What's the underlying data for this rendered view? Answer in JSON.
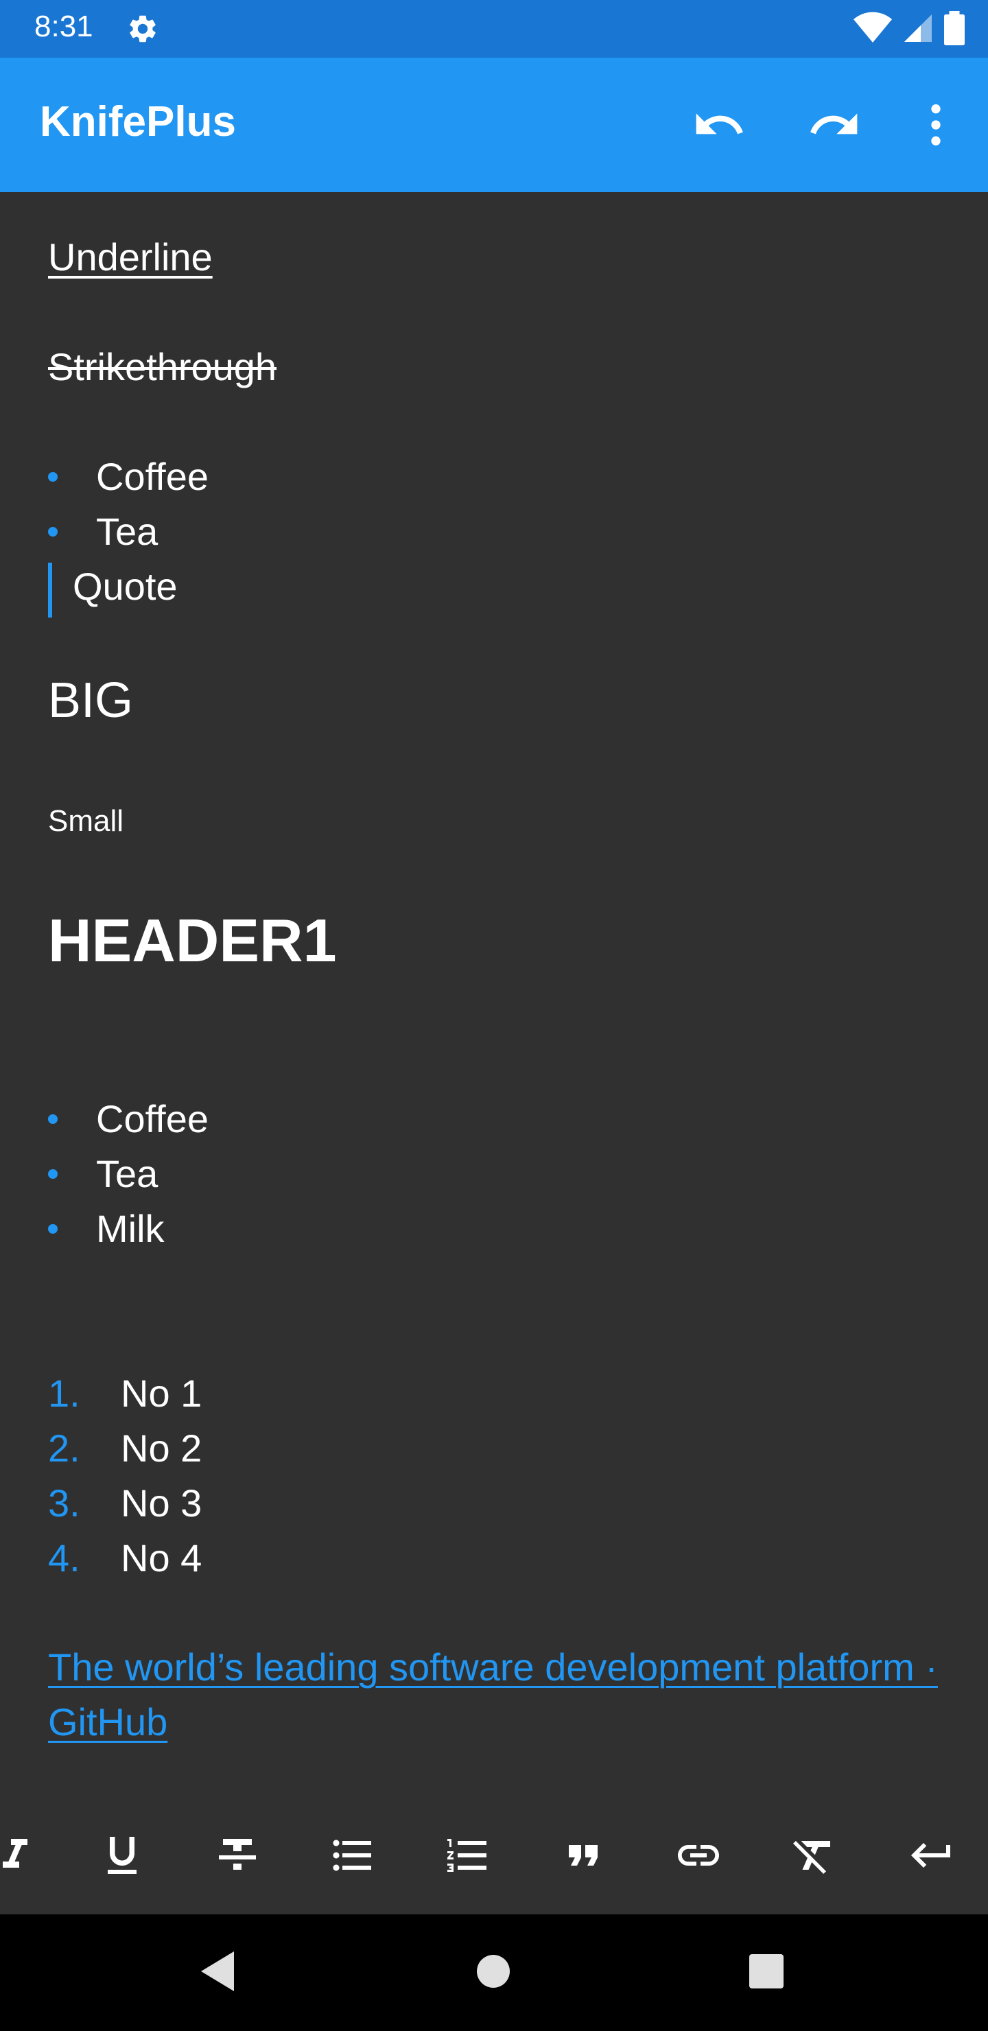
{
  "status_bar": {
    "time": "8:31"
  },
  "app_bar": {
    "title": "KnifePlus"
  },
  "content": {
    "underline": "Underline",
    "strikethrough": "Strikethrough",
    "bullets1": [
      "Coffee",
      "Tea"
    ],
    "quote": "Quote",
    "big": "BIG",
    "small": "Small",
    "header1": "HEADER1",
    "bullets2": [
      "Coffee",
      "Tea",
      "Milk"
    ],
    "numbered": [
      {
        "num": "1.",
        "text": "No 1"
      },
      {
        "num": "2.",
        "text": "No 2"
      },
      {
        "num": "3.",
        "text": "No 3"
      },
      {
        "num": "4.",
        "text": "No 4"
      }
    ],
    "link": "The world’s leading software development platform · GitHub"
  },
  "toolbar": {
    "items": [
      "italic-icon",
      "underline-icon",
      "strikethrough-icon",
      "bullet-list-icon",
      "numbered-list-icon",
      "quote-icon",
      "link-icon",
      "clear-format-icon",
      "enter-icon"
    ]
  },
  "colors": {
    "accent": "#2196F3",
    "status_bar": "#1976D2",
    "background": "#303030"
  }
}
